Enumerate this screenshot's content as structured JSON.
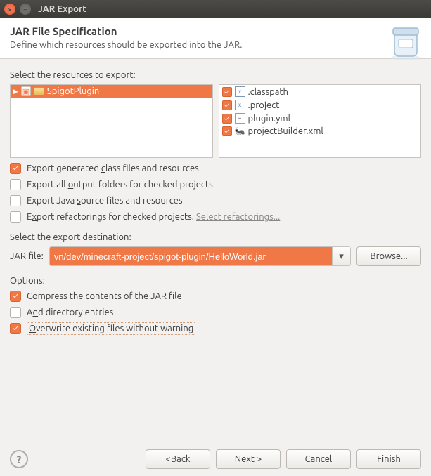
{
  "window": {
    "title": "JAR Export"
  },
  "header": {
    "title": "JAR File Specification",
    "subtitle": "Define which resources should be exported into the JAR."
  },
  "resources": {
    "label": "Select the resources to export:",
    "tree": {
      "project": "SpigotPlugin"
    },
    "files": [
      {
        "name": ".classpath",
        "checked": true,
        "type": "xml"
      },
      {
        "name": ".project",
        "checked": true,
        "type": "xml"
      },
      {
        "name": "plugin.yml",
        "checked": true,
        "type": "doc"
      },
      {
        "name": "projectBuilder.xml",
        "checked": true,
        "type": "ant"
      }
    ]
  },
  "exportOptions": [
    {
      "pre": "Export generated ",
      "mn": "c",
      "post": "lass files and resources",
      "checked": true
    },
    {
      "pre": "Export all ",
      "mn": "o",
      "post": "utput folders for checked projects",
      "checked": false
    },
    {
      "pre": "Export Java ",
      "mn": "s",
      "post": "ource files and resources",
      "checked": false
    },
    {
      "pre": "E",
      "mn": "x",
      "post": "port refactorings for checked projects. ",
      "checked": false,
      "link": "Select refactorings..."
    }
  ],
  "destination": {
    "label": "Select the export destination:",
    "fieldLabelPre": "JAR fil",
    "fieldLabelMn": "e",
    "fieldLabelPost": ":",
    "path": "vn/dev/minecraft-project/spigot-plugin/HelloWorld.jar",
    "browsePre": "B",
    "browseMn": "r",
    "browsePost": "owse..."
  },
  "options": {
    "label": "Options:",
    "items": [
      {
        "pre": "Co",
        "mn": "m",
        "post": "press the contents of the JAR file",
        "checked": true
      },
      {
        "pre": "A",
        "mn": "d",
        "post": "d directory entries",
        "checked": false
      },
      {
        "pre": "",
        "mn": "O",
        "post": "verwrite existing files without warning",
        "checked": true,
        "boxed": true
      }
    ]
  },
  "buttons": {
    "backPre": "< ",
    "backMn": "B",
    "backPost": "ack",
    "nextPre": "",
    "nextMn": "N",
    "nextPost": "ext >",
    "cancel": "Cancel",
    "finishPre": "",
    "finishMn": "F",
    "finishPost": "inish"
  }
}
